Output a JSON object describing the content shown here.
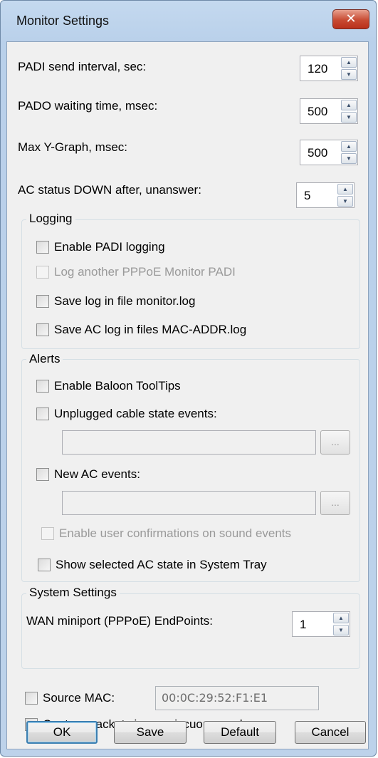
{
  "window": {
    "title": "Monitor Settings",
    "close_glyph": "✕"
  },
  "fields": {
    "padi_interval": {
      "label": "PADI send interval, sec:",
      "value": "120"
    },
    "pado_waiting": {
      "label": "PADO waiting time, msec:",
      "value": "500"
    },
    "max_y_graph": {
      "label": "Max Y-Graph, msec:",
      "value": "500"
    },
    "ac_status_down": {
      "label": "AC status DOWN after, unanswer:",
      "value": "5"
    }
  },
  "logging": {
    "title": "Logging",
    "enable_padi": "Enable PADI logging",
    "log_another": "Log another PPPoE Monitor PADI",
    "save_log": "Save log in file monitor.log",
    "save_ac_log": "Save AC log in files MAC-ADDR.log"
  },
  "alerts": {
    "title": "Alerts",
    "balloon": "Enable Baloon ToolTips",
    "unplugged": "Unplugged cable state events:",
    "unplugged_path": "",
    "new_ac": "New AC events:",
    "new_ac_path": "",
    "browse_label": "...",
    "confirmations": "Enable user confirmations on sound events",
    "show_tray": "Show selected AC state in System Tray"
  },
  "system": {
    "title": "System Settings",
    "endpoints_label": "WAN miniport (PPPoE) EndPoints:",
    "endpoints_value": "1"
  },
  "source_mac": {
    "label": "Source MAC:",
    "value": "00:0C:29:52:F1:E1"
  },
  "promiscuous": "Capture packets in promiscuous mode",
  "buttons": {
    "ok": "OK",
    "save": "Save",
    "default": "Default",
    "cancel": "Cancel"
  },
  "icons": {
    "up": "▲",
    "down": "▼"
  }
}
